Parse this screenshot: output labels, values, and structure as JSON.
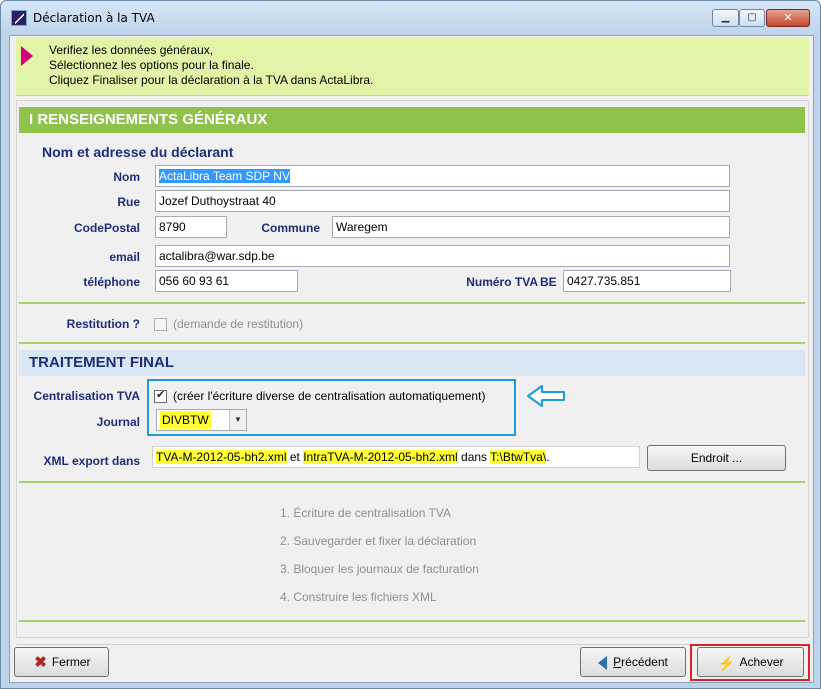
{
  "window": {
    "title": "Déclaration à la TVA",
    "minimize_glyph": "▁",
    "maximize_glyph": "▢",
    "close_glyph": "✕"
  },
  "banner": {
    "lines": [
      "Verifiez les données généraux,",
      "Sélectionnez les options pour la finale.",
      "Cliquez Finaliser pour la déclaration à la TVA dans ActaLibra."
    ]
  },
  "section1": {
    "title": "I  RENSEIGNEMENTS GÉNÉRAUX",
    "subtitle": "Nom et adresse du déclarant"
  },
  "fields": {
    "nom": {
      "label": "Nom",
      "value": "ActaLibra Team SDP NV"
    },
    "rue": {
      "label": "Rue",
      "value": "Jozef Duthoystraat 40"
    },
    "codepostal": {
      "label": "CodePostal",
      "value": "8790"
    },
    "commune": {
      "label": "Commune",
      "value": "Waregem"
    },
    "email": {
      "label": "email",
      "value": "actalibra@war.sdp.be"
    },
    "telephone": {
      "label": "téléphone",
      "value": "056 60 93 61"
    },
    "numero_tva": {
      "label": "Numéro TVA",
      "prefix": "BE",
      "value": "0427.735.851"
    }
  },
  "restitution": {
    "label": "Restitution ?",
    "option": "(demande de restitution)",
    "checked": false,
    "enabled": false
  },
  "section2": {
    "title": "TRAITEMENT FINAL"
  },
  "centralisation": {
    "label": "Centralisation TVA",
    "option": "(créer l'écriture diverse de centralisation automatiquement)",
    "checked": true
  },
  "journal": {
    "label": "Journal",
    "value": "DIVBTW",
    "dropdown_glyph": "▼"
  },
  "xml_export": {
    "label": "XML export dans",
    "file1": "TVA-M-2012-05-bh2.xml",
    "connector1": " et ",
    "file2": "IntraTVA-M-2012-05-bh2.xml",
    "connector2": " dans ",
    "folder": "T:\\BtwTva\\",
    "suffix": ".",
    "button": "Endroit ..."
  },
  "steps": [
    "1. Écriture de centralisation TVA",
    "2. Sauvegarder et fixer la déclaration",
    "3. Bloquer les journaux de facturation",
    "4. Construire les fichiers XML"
  ],
  "footer": {
    "close_button": "Fermer",
    "previous_button_first": "P",
    "previous_button_rest": "récédent",
    "finish_button": "Achever"
  },
  "icons": {
    "close": "close-x-icon",
    "previous": "arrow-left-icon",
    "finish": "lightning-icon",
    "annotation": "annotation-arrow-icon"
  },
  "colors": {
    "banner_bg": "#e1f3a6",
    "section_bar": "#8fc24a",
    "label_text": "#1d2d7a",
    "highlight": "#ffff33",
    "annotation_box": "#1e9ad6",
    "focus_box": "#d9222a"
  }
}
